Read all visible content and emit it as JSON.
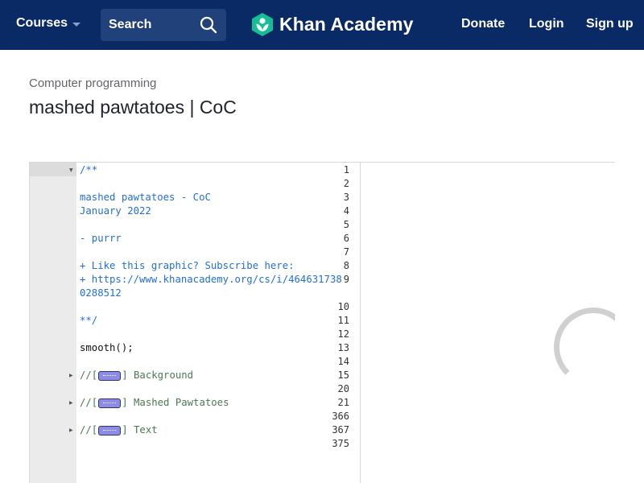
{
  "header": {
    "courses_label": "Courses",
    "search_label": "Search",
    "logo_text": "Khan Academy",
    "donate_label": "Donate",
    "login_label": "Login",
    "signup_label": "Sign up"
  },
  "breadcrumb": "Computer programming",
  "title": "mashed pawtatoes | CoC",
  "editor": {
    "lines": [
      {
        "no": "1",
        "fold": true,
        "text": "/**",
        "kind": "comment"
      },
      {
        "no": "2",
        "fold": false,
        "text": "",
        "kind": "comment"
      },
      {
        "no": "3",
        "fold": false,
        "text": "mashed pawtatoes - CoC",
        "kind": "comment"
      },
      {
        "no": "4",
        "fold": false,
        "text": "January 2022",
        "kind": "comment"
      },
      {
        "no": "5",
        "fold": false,
        "text": "",
        "kind": "comment"
      },
      {
        "no": "6",
        "fold": false,
        "text": "- purrr",
        "kind": "comment"
      },
      {
        "no": "7",
        "fold": false,
        "text": "",
        "kind": "comment"
      },
      {
        "no": "8",
        "fold": false,
        "text": "+ Like this graphic? Subscribe here:",
        "kind": "comment"
      },
      {
        "no": "9",
        "fold": false,
        "text": "+ https://www.khanacademy.org/cs/i/464631738",
        "kind": "comment"
      },
      {
        "no": "",
        "fold": false,
        "text": "0288512",
        "kind": "comment"
      },
      {
        "no": "10",
        "fold": false,
        "text": "",
        "kind": "comment"
      },
      {
        "no": "11",
        "fold": false,
        "text": "**/",
        "kind": "comment"
      },
      {
        "no": "12",
        "fold": false,
        "text": "",
        "kind": "plain"
      },
      {
        "no": "13",
        "fold": false,
        "text": "smooth();",
        "kind": "plain"
      },
      {
        "no": "14",
        "fold": false,
        "text": "",
        "kind": "plain"
      },
      {
        "no": "15",
        "fold": true,
        "prefix": "//[",
        "suffix": "] Background",
        "kind": "folded"
      },
      {
        "no": "20",
        "fold": false,
        "text": "",
        "kind": "plain"
      },
      {
        "no": "21",
        "fold": true,
        "prefix": "//[",
        "suffix": "] Mashed Pawtatoes",
        "kind": "folded"
      },
      {
        "no": "366",
        "fold": false,
        "text": "",
        "kind": "plain"
      },
      {
        "no": "367",
        "fold": true,
        "prefix": "//[",
        "suffix": "] Text",
        "kind": "folded"
      },
      {
        "no": "375",
        "fold": false,
        "text": "",
        "kind": "plain"
      }
    ]
  },
  "colors": {
    "header_bg": "#0a2a66",
    "comment": "#236fd6",
    "folded_text": "#4a7a52",
    "logo_green": "#14bf96"
  }
}
